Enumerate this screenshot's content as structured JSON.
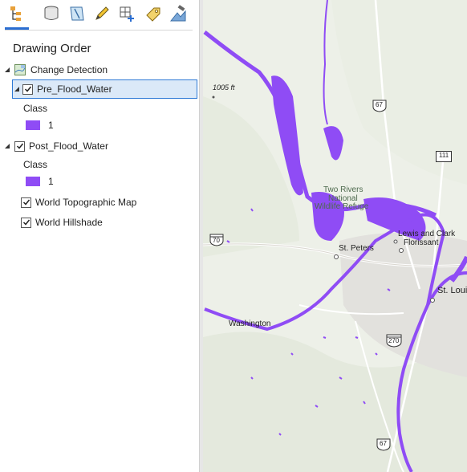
{
  "panel": {
    "title": "Drawing Order",
    "toolbar": [
      {
        "icon": "list-by-drawing-order-icon"
      },
      {
        "icon": "list-by-source-icon"
      },
      {
        "icon": "list-by-selection-icon"
      },
      {
        "icon": "list-by-editing-icon"
      },
      {
        "icon": "list-by-snapping-icon"
      },
      {
        "icon": "list-by-labeling-icon"
      },
      {
        "icon": "list-by-perspective-imagery-icon"
      }
    ],
    "group": {
      "label": "Change Detection",
      "expanded": true
    },
    "layers": [
      {
        "label": "Pre_Flood_Water",
        "checked": true,
        "selected": true,
        "class_header": "Class",
        "class_value": "1",
        "color": "#8f4cf5"
      },
      {
        "label": "Post_Flood_Water",
        "checked": true,
        "selected": false,
        "class_header": "Class",
        "class_value": "1",
        "color": "#8f4cf5"
      },
      {
        "label": "World Topographic Map",
        "checked": true
      },
      {
        "label": "World Hillshade",
        "checked": true
      }
    ]
  },
  "map": {
    "water_color": "#8f4cf5",
    "elevation_label": "1005 ft",
    "places": {
      "twin_rivers_1": "Two Rivers",
      "twin_rivers_2": "National",
      "twin_rivers_3": "Wildlife Refuge",
      "lewis": "Lewis and Clark",
      "florissant": "Florissant",
      "st_peters": "St. Peters",
      "st_louis": "St. Louis",
      "washington": "Washington"
    },
    "shields": {
      "us67_top": "67",
      "route111": "111",
      "i70": "70",
      "i270": "270",
      "us67_bottom": "67"
    }
  }
}
